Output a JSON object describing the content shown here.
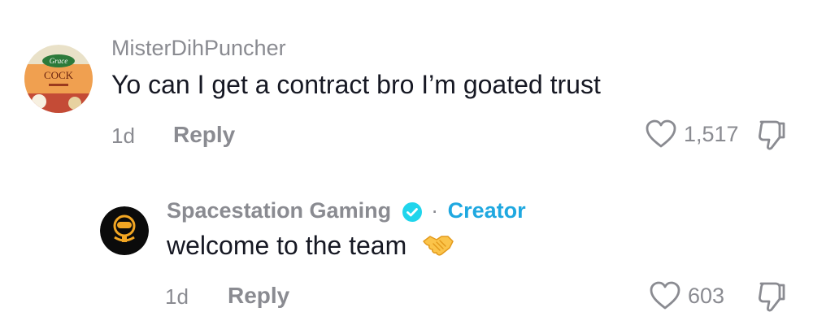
{
  "comments": [
    {
      "username": "MisterDihPuncher",
      "avatar_text": "COCK",
      "avatar_brand": "Grace",
      "text": "Yo can I get a contract bro I’m goated trust",
      "time": "1d",
      "reply_label": "Reply",
      "likes": "1,517"
    },
    {
      "username": "Spacestation Gaming",
      "verified": true,
      "separator": "·",
      "creator_label": "Creator",
      "text": "welcome to the team",
      "emoji": "handshake",
      "time": "1d",
      "reply_label": "Reply",
      "likes": "603"
    }
  ],
  "colors": {
    "muted": "#8a8b91",
    "text": "#161823",
    "creator": "#1fa8e0",
    "verified": "#20d5ec"
  }
}
